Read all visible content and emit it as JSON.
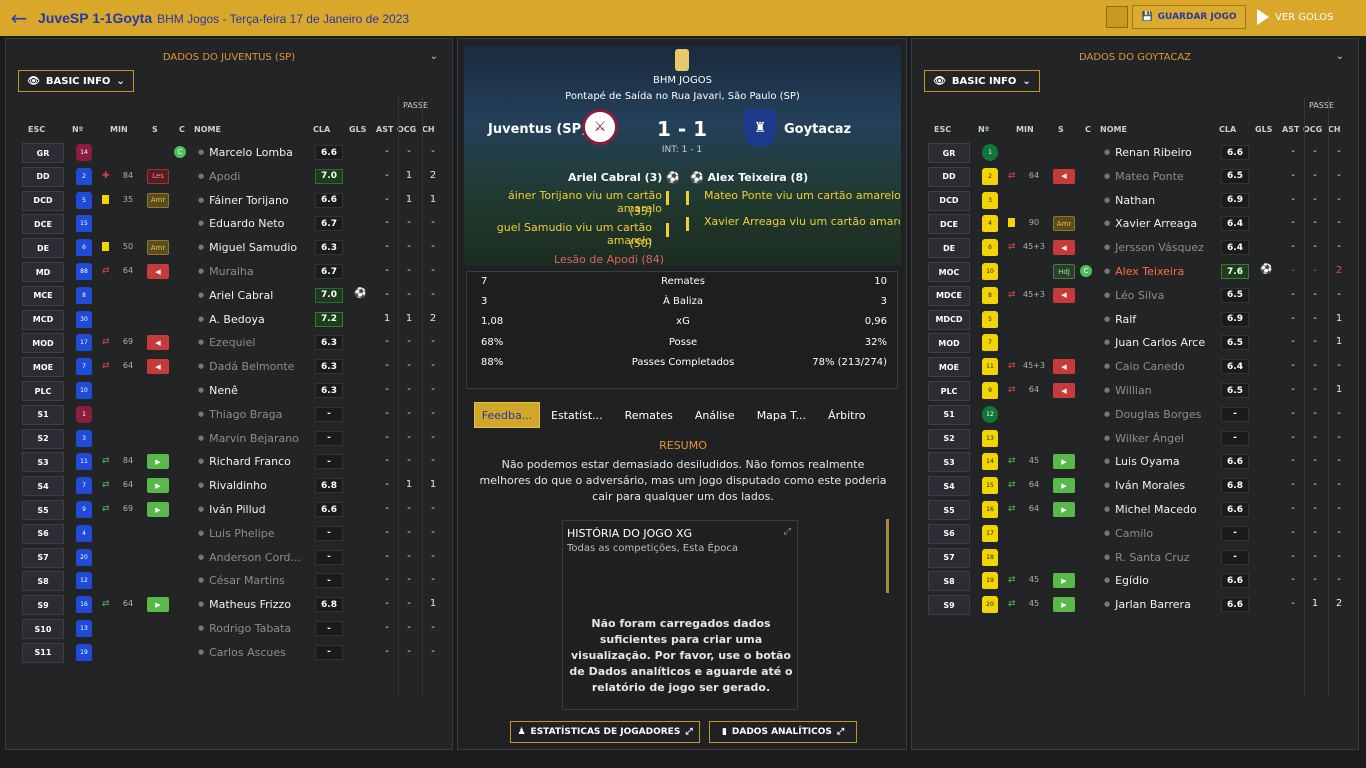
{
  "topbar": {
    "title": "JuveSP 1-1Goyta",
    "subtitle": "BHM Jogos - Terça-feira 17 de Janeiro de 2023",
    "save_label": "GUARDAR JOGO",
    "watch_label": "VER GOLOS"
  },
  "colors": {
    "topbar": "#d9a72a",
    "accent": "#c9951f",
    "title": "#2538a7",
    "home_shirt": "#1f4bd6",
    "away_shirt": "#f2d500"
  },
  "left": {
    "header": "DADOS DO JUVENTUS (SP)",
    "basic_info": "BASIC INFO",
    "columns": {
      "esc": "ESC",
      "num": "Nº",
      "min": "MIN",
      "s": "S",
      "c": "C",
      "nome": "NOME",
      "cla": "CLA",
      "gls": "GLS",
      "ast": "AST",
      "ocg": "OCG",
      "ch": "CH",
      "passe": "PASSE"
    },
    "rows": [
      {
        "pos": "GR",
        "num": "14",
        "shirt": "maroon",
        "sub": "",
        "min": "",
        "flag": "",
        "c": true,
        "name": "Marcelo Lomba",
        "dim": false,
        "rating": "6.6",
        "gls": "",
        "ast": "-",
        "ocg": "-",
        "ch": "-"
      },
      {
        "pos": "DD",
        "num": "2",
        "shirt": "blue",
        "sub": "injury",
        "min": "84",
        "flag": "Les",
        "flagtype": "les",
        "c": false,
        "name": "Apodi",
        "dim": true,
        "rating": "7.0",
        "rclass": "good",
        "gls": "",
        "ast": "-",
        "ocg": "1",
        "ch": "2"
      },
      {
        "pos": "DCD",
        "num": "5",
        "shirt": "blue",
        "sub": "yellow",
        "min": "35",
        "flag": "Amr",
        "flagtype": "amr",
        "c": false,
        "name": "Fáiner Torijano",
        "dim": false,
        "rating": "6.6",
        "gls": "",
        "ast": "-",
        "ocg": "1",
        "ch": "1"
      },
      {
        "pos": "DCE",
        "num": "15",
        "shirt": "blue",
        "sub": "",
        "min": "",
        "flag": "",
        "c": false,
        "name": "Eduardo Neto",
        "dim": false,
        "rating": "6.7",
        "gls": "",
        "ast": "-",
        "ocg": "-",
        "ch": "-"
      },
      {
        "pos": "DE",
        "num": "6",
        "shirt": "blue",
        "sub": "yellow",
        "min": "50",
        "flag": "Amr",
        "flagtype": "amr",
        "c": false,
        "name": "Miguel Samudio",
        "dim": false,
        "rating": "6.3",
        "gls": "",
        "ast": "-",
        "ocg": "-",
        "ch": "-"
      },
      {
        "pos": "MD",
        "num": "88",
        "shirt": "blue",
        "sub": "out",
        "min": "64",
        "flag": "◀",
        "flagtype": "red",
        "c": false,
        "name": "Muralha",
        "dim": true,
        "rating": "6.7",
        "gls": "",
        "ast": "-",
        "ocg": "-",
        "ch": "-"
      },
      {
        "pos": "MCE",
        "num": "8",
        "shirt": "blue",
        "sub": "",
        "min": "",
        "flag": "",
        "c": false,
        "name": "Ariel Cabral",
        "dim": false,
        "rating": "7.0",
        "rclass": "good",
        "gls": "⚽",
        "ast": "-",
        "ocg": "-",
        "ch": "-"
      },
      {
        "pos": "MCD",
        "num": "30",
        "shirt": "blue",
        "sub": "",
        "min": "",
        "flag": "",
        "c": false,
        "name": "A. Bedoya",
        "dim": false,
        "rating": "7.2",
        "rclass": "great",
        "gls": "",
        "ast": "1",
        "ocg": "1",
        "ch": "2"
      },
      {
        "pos": "MOD",
        "num": "17",
        "shirt": "blue",
        "sub": "out",
        "min": "69",
        "flag": "◀",
        "flagtype": "red",
        "c": false,
        "name": "Ezequiel",
        "dim": true,
        "rating": "6.3",
        "gls": "",
        "ast": "-",
        "ocg": "-",
        "ch": "-"
      },
      {
        "pos": "MOE",
        "num": "7",
        "shirt": "blue",
        "sub": "out",
        "min": "64",
        "flag": "◀",
        "flagtype": "red",
        "c": false,
        "name": "Dadá Belmonte",
        "dim": true,
        "rating": "6.3",
        "gls": "",
        "ast": "-",
        "ocg": "-",
        "ch": "-"
      },
      {
        "pos": "PLC",
        "num": "10",
        "shirt": "blue",
        "sub": "",
        "min": "",
        "flag": "",
        "c": false,
        "name": "Nenê",
        "dim": false,
        "rating": "6.3",
        "gls": "",
        "ast": "-",
        "ocg": "-",
        "ch": "-"
      },
      {
        "pos": "S1",
        "num": "1",
        "shirt": "maroon",
        "sub": "",
        "min": "",
        "flag": "",
        "c": false,
        "name": "Thiago Braga",
        "dim": true,
        "rating": "-",
        "gls": "",
        "ast": "-",
        "ocg": "-",
        "ch": "-"
      },
      {
        "pos": "S2",
        "num": "3",
        "shirt": "blue",
        "sub": "",
        "min": "",
        "flag": "",
        "c": false,
        "name": "Marvin Bejarano",
        "dim": true,
        "rating": "-",
        "gls": "",
        "ast": "-",
        "ocg": "-",
        "ch": "-"
      },
      {
        "pos": "S3",
        "num": "11",
        "shirt": "blue",
        "sub": "in",
        "min": "84",
        "flag": "▶",
        "flagtype": "grn",
        "c": false,
        "name": "Richard Franco",
        "dim": false,
        "rating": "-",
        "gls": "",
        "ast": "-",
        "ocg": "-",
        "ch": "-"
      },
      {
        "pos": "S4",
        "num": "7",
        "shirt": "blue",
        "sub": "in",
        "min": "64",
        "flag": "▶",
        "flagtype": "grn",
        "c": false,
        "name": "Rivaldinho",
        "dim": false,
        "rating": "6.8",
        "gls": "",
        "ast": "-",
        "ocg": "1",
        "ch": "1"
      },
      {
        "pos": "S5",
        "num": "9",
        "shirt": "blue",
        "sub": "in",
        "min": "69",
        "flag": "▶",
        "flagtype": "grn",
        "c": false,
        "name": "Iván Pillud",
        "dim": false,
        "rating": "6.6",
        "gls": "",
        "ast": "-",
        "ocg": "-",
        "ch": "-"
      },
      {
        "pos": "S6",
        "num": "4",
        "shirt": "blue",
        "sub": "",
        "min": "",
        "flag": "",
        "c": false,
        "name": "Luis Phelipe",
        "dim": true,
        "rating": "-",
        "gls": "",
        "ast": "-",
        "ocg": "-",
        "ch": "-"
      },
      {
        "pos": "S7",
        "num": "20",
        "shirt": "blue",
        "sub": "",
        "min": "",
        "flag": "",
        "c": false,
        "name": "Anderson Cord...",
        "dim": true,
        "rating": "-",
        "gls": "",
        "ast": "-",
        "ocg": "-",
        "ch": "-"
      },
      {
        "pos": "S8",
        "num": "12",
        "shirt": "blue",
        "sub": "",
        "min": "",
        "flag": "",
        "c": false,
        "name": "César Martins",
        "dim": true,
        "rating": "-",
        "gls": "",
        "ast": "-",
        "ocg": "-",
        "ch": "-"
      },
      {
        "pos": "S9",
        "num": "16",
        "shirt": "blue",
        "sub": "in",
        "min": "64",
        "flag": "▶",
        "flagtype": "grn",
        "c": false,
        "name": "Matheus Frizzo",
        "dim": false,
        "rating": "6.8",
        "gls": "",
        "ast": "-",
        "ocg": "-",
        "ch": "1"
      },
      {
        "pos": "S10",
        "num": "13",
        "shirt": "blue",
        "sub": "",
        "min": "",
        "flag": "",
        "c": false,
        "name": "Rodrigo Tabata",
        "dim": true,
        "rating": "-",
        "gls": "",
        "ast": "-",
        "ocg": "-",
        "ch": "-"
      },
      {
        "pos": "S11",
        "num": "19",
        "shirt": "blue",
        "sub": "",
        "min": "",
        "flag": "",
        "c": false,
        "name": "Carlos Ascues",
        "dim": true,
        "rating": "-",
        "gls": "",
        "ast": "-",
        "ocg": "-",
        "ch": "-"
      }
    ]
  },
  "right": {
    "header": "DADOS DO GOYTACAZ",
    "basic_info": "BASIC INFO",
    "columns": {
      "esc": "ESC",
      "num": "Nº",
      "min": "MIN",
      "s": "S",
      "c": "C",
      "nome": "NOME",
      "cla": "CLA",
      "gls": "GLS",
      "ast": "AST",
      "ocg": "OCG",
      "ch": "CH",
      "passe": "PASSE"
    },
    "rows": [
      {
        "pos": "GR",
        "num": "1",
        "shirt": "green",
        "sub": "",
        "min": "",
        "flag": "",
        "name": "Renan Ribeiro",
        "dim": false,
        "rating": "6.6",
        "gls": "",
        "ast": "-",
        "ocg": "-",
        "ch": "-"
      },
      {
        "pos": "DD",
        "num": "2",
        "shirt": "yellow",
        "sub": "out",
        "min": "64",
        "flag": "◀",
        "flagtype": "red",
        "name": "Mateo Ponte",
        "dim": true,
        "rating": "6.5",
        "gls": "",
        "ast": "-",
        "ocg": "-",
        "ch": "-"
      },
      {
        "pos": "DCD",
        "num": "3",
        "shirt": "yellow",
        "sub": "",
        "min": "",
        "flag": "",
        "name": "Nathan",
        "dim": false,
        "rating": "6.9",
        "gls": "",
        "ast": "-",
        "ocg": "-",
        "ch": "-"
      },
      {
        "pos": "DCE",
        "num": "4",
        "shirt": "yellow",
        "sub": "yellow",
        "min": "90",
        "flag": "Amr",
        "flagtype": "amr",
        "name": "Xavier Arreaga",
        "dim": false,
        "rating": "6.4",
        "gls": "",
        "ast": "-",
        "ocg": "-",
        "ch": "-"
      },
      {
        "pos": "DE",
        "num": "6",
        "shirt": "yellow",
        "sub": "out",
        "min": "45+3",
        "flag": "◀",
        "flagtype": "red",
        "name": "Jersson Vásquez",
        "dim": true,
        "rating": "6.4",
        "gls": "",
        "ast": "-",
        "ocg": "-",
        "ch": "-"
      },
      {
        "pos": "MOC",
        "num": "10",
        "shirt": "yellow",
        "sub": "",
        "min": "",
        "flag": "HdJ",
        "flagtype": "hdj",
        "c": true,
        "name": "Alex Teixeira",
        "dim": false,
        "red": true,
        "rating": "7.6",
        "rclass": "great",
        "gls": "⚽",
        "ast": "-",
        "ocg": "-",
        "ch": "2",
        "statred": true
      },
      {
        "pos": "MDCE",
        "num": "8",
        "shirt": "yellow",
        "sub": "out",
        "min": "45+3",
        "flag": "◀",
        "flagtype": "red",
        "name": "Léo Silva",
        "dim": true,
        "rating": "6.5",
        "gls": "",
        "ast": "-",
        "ocg": "-",
        "ch": "-"
      },
      {
        "pos": "MDCD",
        "num": "5",
        "shirt": "yellow",
        "sub": "",
        "min": "",
        "flag": "",
        "name": "Ralf",
        "dim": false,
        "rating": "6.9",
        "gls": "",
        "ast": "-",
        "ocg": "-",
        "ch": "1"
      },
      {
        "pos": "MOD",
        "num": "7",
        "shirt": "yellow",
        "sub": "",
        "min": "",
        "flag": "",
        "name": "Juan Carlos Arce",
        "dim": false,
        "rating": "6.5",
        "gls": "",
        "ast": "-",
        "ocg": "-",
        "ch": "1"
      },
      {
        "pos": "MOE",
        "num": "11",
        "shirt": "yellow",
        "sub": "out",
        "min": "45+3",
        "flag": "◀",
        "flagtype": "red",
        "name": "Caio Canedo",
        "dim": true,
        "rating": "6.4",
        "gls": "",
        "ast": "-",
        "ocg": "-",
        "ch": "-"
      },
      {
        "pos": "PLC",
        "num": "9",
        "shirt": "yellow",
        "sub": "out",
        "min": "64",
        "flag": "◀",
        "flagtype": "red",
        "name": "Willian",
        "dim": true,
        "rating": "6.5",
        "gls": "",
        "ast": "-",
        "ocg": "-",
        "ch": "1"
      },
      {
        "pos": "S1",
        "num": "12",
        "shirt": "green",
        "sub": "",
        "min": "",
        "flag": "",
        "name": "Douglas Borges",
        "dim": true,
        "rating": "-",
        "gls": "",
        "ast": "-",
        "ocg": "-",
        "ch": "-"
      },
      {
        "pos": "S2",
        "num": "13",
        "shirt": "yellow",
        "sub": "",
        "min": "",
        "flag": "",
        "name": "Wilker Ángel",
        "dim": true,
        "rating": "-",
        "gls": "",
        "ast": "-",
        "ocg": "-",
        "ch": "-"
      },
      {
        "pos": "S3",
        "num": "14",
        "shirt": "yellow",
        "sub": "in",
        "min": "45",
        "flag": "▶",
        "flagtype": "grn",
        "name": "Luis Oyama",
        "dim": false,
        "rating": "6.6",
        "gls": "",
        "ast": "-",
        "ocg": "-",
        "ch": "-"
      },
      {
        "pos": "S4",
        "num": "15",
        "shirt": "yellow",
        "sub": "in",
        "min": "64",
        "flag": "▶",
        "flagtype": "grn",
        "name": "Iván Morales",
        "dim": false,
        "rating": "6.8",
        "gls": "",
        "ast": "-",
        "ocg": "-",
        "ch": "-"
      },
      {
        "pos": "S5",
        "num": "16",
        "shirt": "yellow",
        "sub": "in",
        "min": "64",
        "flag": "▶",
        "flagtype": "grn",
        "name": "Michel Macedo",
        "dim": false,
        "rating": "6.6",
        "gls": "",
        "ast": "-",
        "ocg": "-",
        "ch": "-"
      },
      {
        "pos": "S6",
        "num": "17",
        "shirt": "yellow",
        "sub": "",
        "min": "",
        "flag": "",
        "name": "Camilo",
        "dim": true,
        "rating": "-",
        "gls": "",
        "ast": "-",
        "ocg": "-",
        "ch": "-"
      },
      {
        "pos": "S7",
        "num": "18",
        "shirt": "yellow",
        "sub": "",
        "min": "",
        "flag": "",
        "name": "R. Santa Cruz",
        "dim": true,
        "rating": "-",
        "gls": "",
        "ast": "-",
        "ocg": "-",
        "ch": "-"
      },
      {
        "pos": "S8",
        "num": "19",
        "shirt": "yellow",
        "sub": "in",
        "min": "45",
        "flag": "▶",
        "flagtype": "grn",
        "name": "Egídio",
        "dim": false,
        "rating": "6.6",
        "gls": "",
        "ast": "-",
        "ocg": "-",
        "ch": "-"
      },
      {
        "pos": "S9",
        "num": "20",
        "shirt": "yellow",
        "sub": "in",
        "min": "45",
        "flag": "▶",
        "flagtype": "grn",
        "name": "Jarlan Barrera",
        "dim": false,
        "rating": "6.6",
        "gls": "",
        "ast": "-",
        "ocg": "1",
        "ch": "2"
      }
    ]
  },
  "match": {
    "competition": "BHM JOGOS",
    "venue": "Pontapé de Saída no Rua Javari, São Paulo (SP)",
    "home": "Juventus (SP)",
    "away": "Goytacaz",
    "score": "1 - 1",
    "ht": "INT: 1 - 1",
    "home_scorer": "Ariel Cabral (3)",
    "away_scorer": "Alex Teixeira (8)",
    "home_events": [
      "áiner Torijano viu um cartão amarelo",
      "(35)",
      "guel Samudio viu um cartão amarelo",
      "(50)",
      "Lesão de Apodi (84)"
    ],
    "away_events": [
      "Mateo Ponte viu um cartão amarelo (4",
      "Xavier Arreaga viu um cartão amarelo"
    ]
  },
  "stats": [
    {
      "home": "7",
      "label": "Remates",
      "away": "10"
    },
    {
      "home": "3",
      "label": "À Baliza",
      "away": "3"
    },
    {
      "home": "1,08",
      "label": "xG",
      "away": "0,96"
    },
    {
      "home": "68%",
      "label": "Posse",
      "away": "32%"
    },
    {
      "home": "88%",
      "label": "Passes Completados",
      "away": "78% (213/274)"
    }
  ],
  "tabs": [
    "Feedba...",
    "Estatíst...",
    "Remates",
    "Análise",
    "Mapa T...",
    "Árbitro"
  ],
  "resumo": {
    "title": "RESUMO",
    "text": "Não podemos estar demasiado desiludidos. Não fomos realmente melhores do que o adversário, mas um jogo disputado como este poderia cair para qualquer um dos lados."
  },
  "xg": {
    "title": "HISTÓRIA DO JOGO XG",
    "subtitle": "Todas as competições, Esta Época",
    "message": "Não foram carregados dados suficientes para criar uma visualização. Por favor, use o botão de Dados analíticos e aguarde até o relatório de jogo ser gerado."
  },
  "buttons": {
    "player_stats": "ESTATÍSTICAS DE JOGADORES",
    "analytics": "DADOS ANALÍTICOS"
  }
}
